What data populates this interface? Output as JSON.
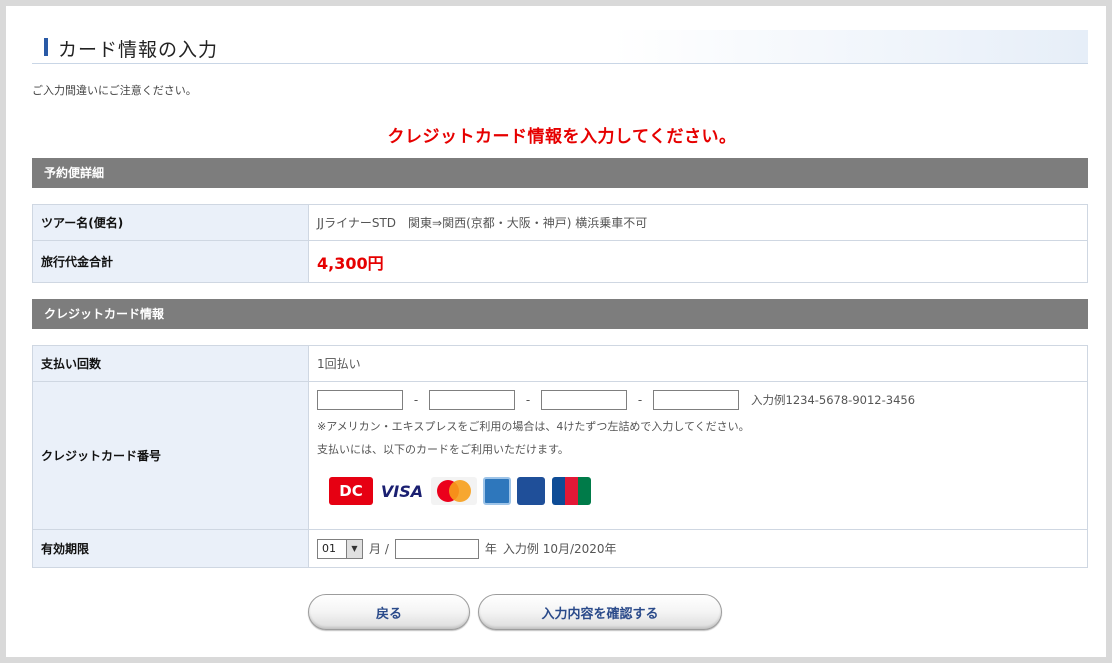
{
  "page": {
    "title": "カード情報の入力",
    "note": "ご入力間違いにご注意ください。",
    "alert": "クレジットカード情報を入力してください。"
  },
  "reservation": {
    "header": "予約便詳細",
    "rows": [
      {
        "label": "ツアー名(便名)",
        "value": "JJライナーSTD　関東⇒関西(京都・大阪・神戸) 横浜乗車不可"
      },
      {
        "label": "旅行代金合計",
        "value": "4,300円"
      }
    ]
  },
  "credit": {
    "header": "クレジットカード情報",
    "installments_label": "支払い回数",
    "installments_value": "1回払い",
    "card_number_label": "クレジットカード番号",
    "card_dash": "-",
    "card_inputs": [
      "",
      "",
      "",
      ""
    ],
    "card_example": "入力例1234-5678-9012-3456",
    "amex_note": "※アメリカン・エキスプレスをご利用の場合は、4けたずつ左詰めで入力してください。",
    "brands_note": "支払いには、以下のカードをご利用いただけます。",
    "brand_logos": [
      "DC",
      "VISA",
      "MasterCard",
      "AMEX",
      "card",
      "JCB"
    ],
    "expiry_label": "有効期限",
    "expiry_month": "01",
    "expiry_month_unit": "月 /",
    "expiry_year": "",
    "expiry_year_unit": "年",
    "expiry_example": "入力例 10月/2020年"
  },
  "buttons": {
    "back": "戻る",
    "confirm": "入力内容を確認する"
  },
  "colors": {
    "accent_red": "#e60000",
    "label_bg": "#eaf0f9",
    "section_header_bg": "#7d7d7d",
    "title_mark": "#2a5aa6"
  }
}
